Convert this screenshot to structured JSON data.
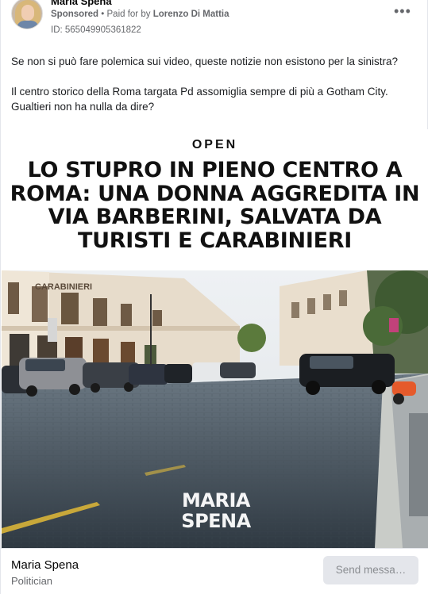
{
  "post": {
    "author": "Maria Spena",
    "sponsored_label": "Sponsored",
    "separator": "•",
    "paid_for_prefix": "Paid for by",
    "paid_for_name": "Lorenzo Di Mattia",
    "ad_id": "ID: 565049905361822",
    "more_icon": "more-options-icon",
    "text_paragraph_1": "Se non si può fare polemica sui video, queste notizie non esistono per la sinistra?",
    "text_paragraph_2": "Il centro storico della Roma targata Pd assomiglia sempre di più a Gotham City. Gualtieri non ha nulla da dire?"
  },
  "media": {
    "source_logo": "OPEN",
    "headline": "LO STUPRO IN PIENO CENTRO A ROMA: UNA DONNA AGGREDITA IN VIA BARBERINI, SALVATA DA TURISTI E CARABINIERI",
    "building_sign": "CARABINIERI",
    "watermark_line_1": "MARIA",
    "watermark_line_2": "SPENA"
  },
  "footer": {
    "page_name": "Maria Spena",
    "page_category": "Politician",
    "send_button": "Send messa…"
  },
  "colors": {
    "muted_text": "#65676b",
    "button_bg": "#e4e6eb",
    "button_text": "#8a8d91"
  }
}
